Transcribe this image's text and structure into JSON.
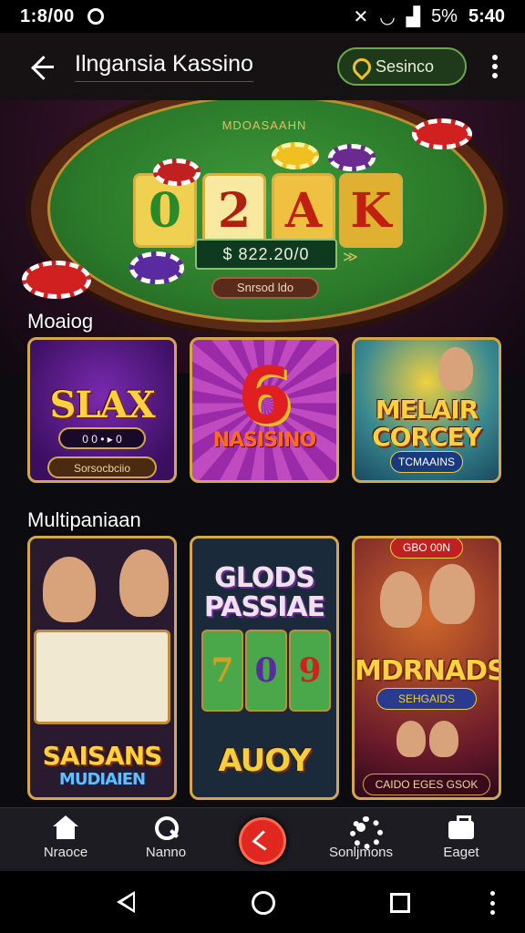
{
  "status_bar": {
    "time": "1:8/00",
    "battery": "5%",
    "clock": "5:40"
  },
  "app_bar": {
    "title": "Ilngansia Kassino",
    "chip_label": "Sesinco"
  },
  "hero": {
    "felt_label": "MDOASAAHN",
    "tiles": [
      "0",
      "2",
      "A",
      "K"
    ],
    "amount": "$ 822.20/0",
    "button_label": "Snrsod ldo"
  },
  "sections": [
    {
      "title": "Moaiog",
      "games": [
        {
          "title": "SLAX",
          "subtitle": "0 0 • ▸ 0",
          "button": "Sorsocbciio"
        },
        {
          "title": "6",
          "subtitle": "NASISINO"
        },
        {
          "title": "MELAIR CORCEY",
          "subtitle": "TCMAAINS"
        }
      ]
    },
    {
      "title": "Multipaniaan",
      "games": [
        {
          "title": "SAISANS",
          "subtitle": "MUDIAIEN"
        },
        {
          "title": "GLODS PASSIAE",
          "reels": [
            "7",
            "0",
            "9"
          ],
          "bottom": "AUOY"
        },
        {
          "title": "MDRNADS",
          "badge": "GBO 00N",
          "subtitle": "SEHGAIDS",
          "footer": "CAIDO EGES GSOK"
        }
      ]
    }
  ],
  "bottom_nav": [
    {
      "label": "Nraoce",
      "icon": "home-icon"
    },
    {
      "label": "Nanno",
      "icon": "search-icon"
    },
    {
      "label": "",
      "icon": "play-icon"
    },
    {
      "label": "Sonljmons",
      "icon": "gear-icon"
    },
    {
      "label": "Eaget",
      "icon": "bag-icon"
    }
  ],
  "colors": {
    "accent": "#d4a84a",
    "fab": "#e02820",
    "felt": "#2b7a2a"
  }
}
